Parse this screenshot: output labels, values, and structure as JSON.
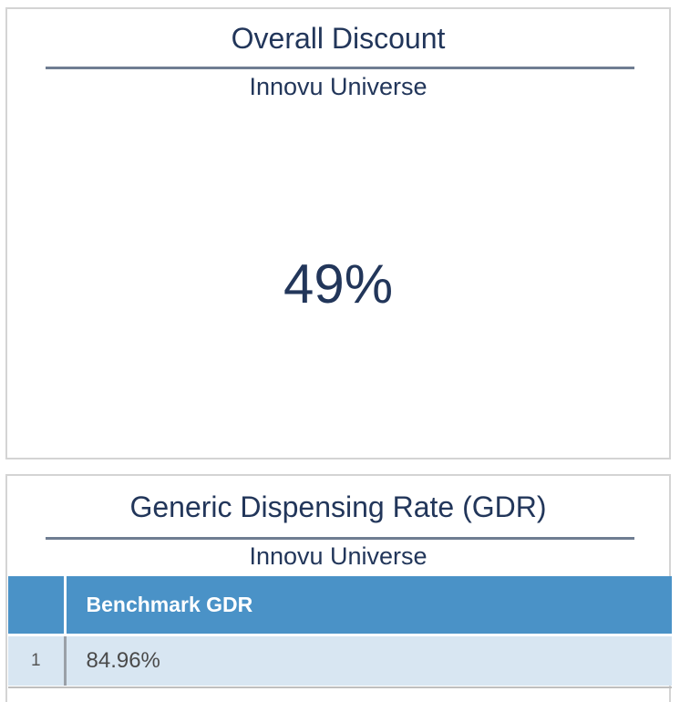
{
  "discount_card": {
    "title": "Overall Discount",
    "subtitle": "Innovu Universe",
    "value": "49%"
  },
  "gdr_card": {
    "title": "Generic Dispensing Rate (GDR)",
    "subtitle": "Innovu Universe",
    "table": {
      "columns": [
        "Benchmark GDR"
      ],
      "rows": [
        {
          "index": "1",
          "value": "84.96%"
        }
      ]
    }
  },
  "colors": {
    "text": "#22365a",
    "header_bg": "#4a92c7",
    "row_bg": "#d8e6f2",
    "rule": "#6f7d92",
    "border": "#d4d4d4"
  }
}
